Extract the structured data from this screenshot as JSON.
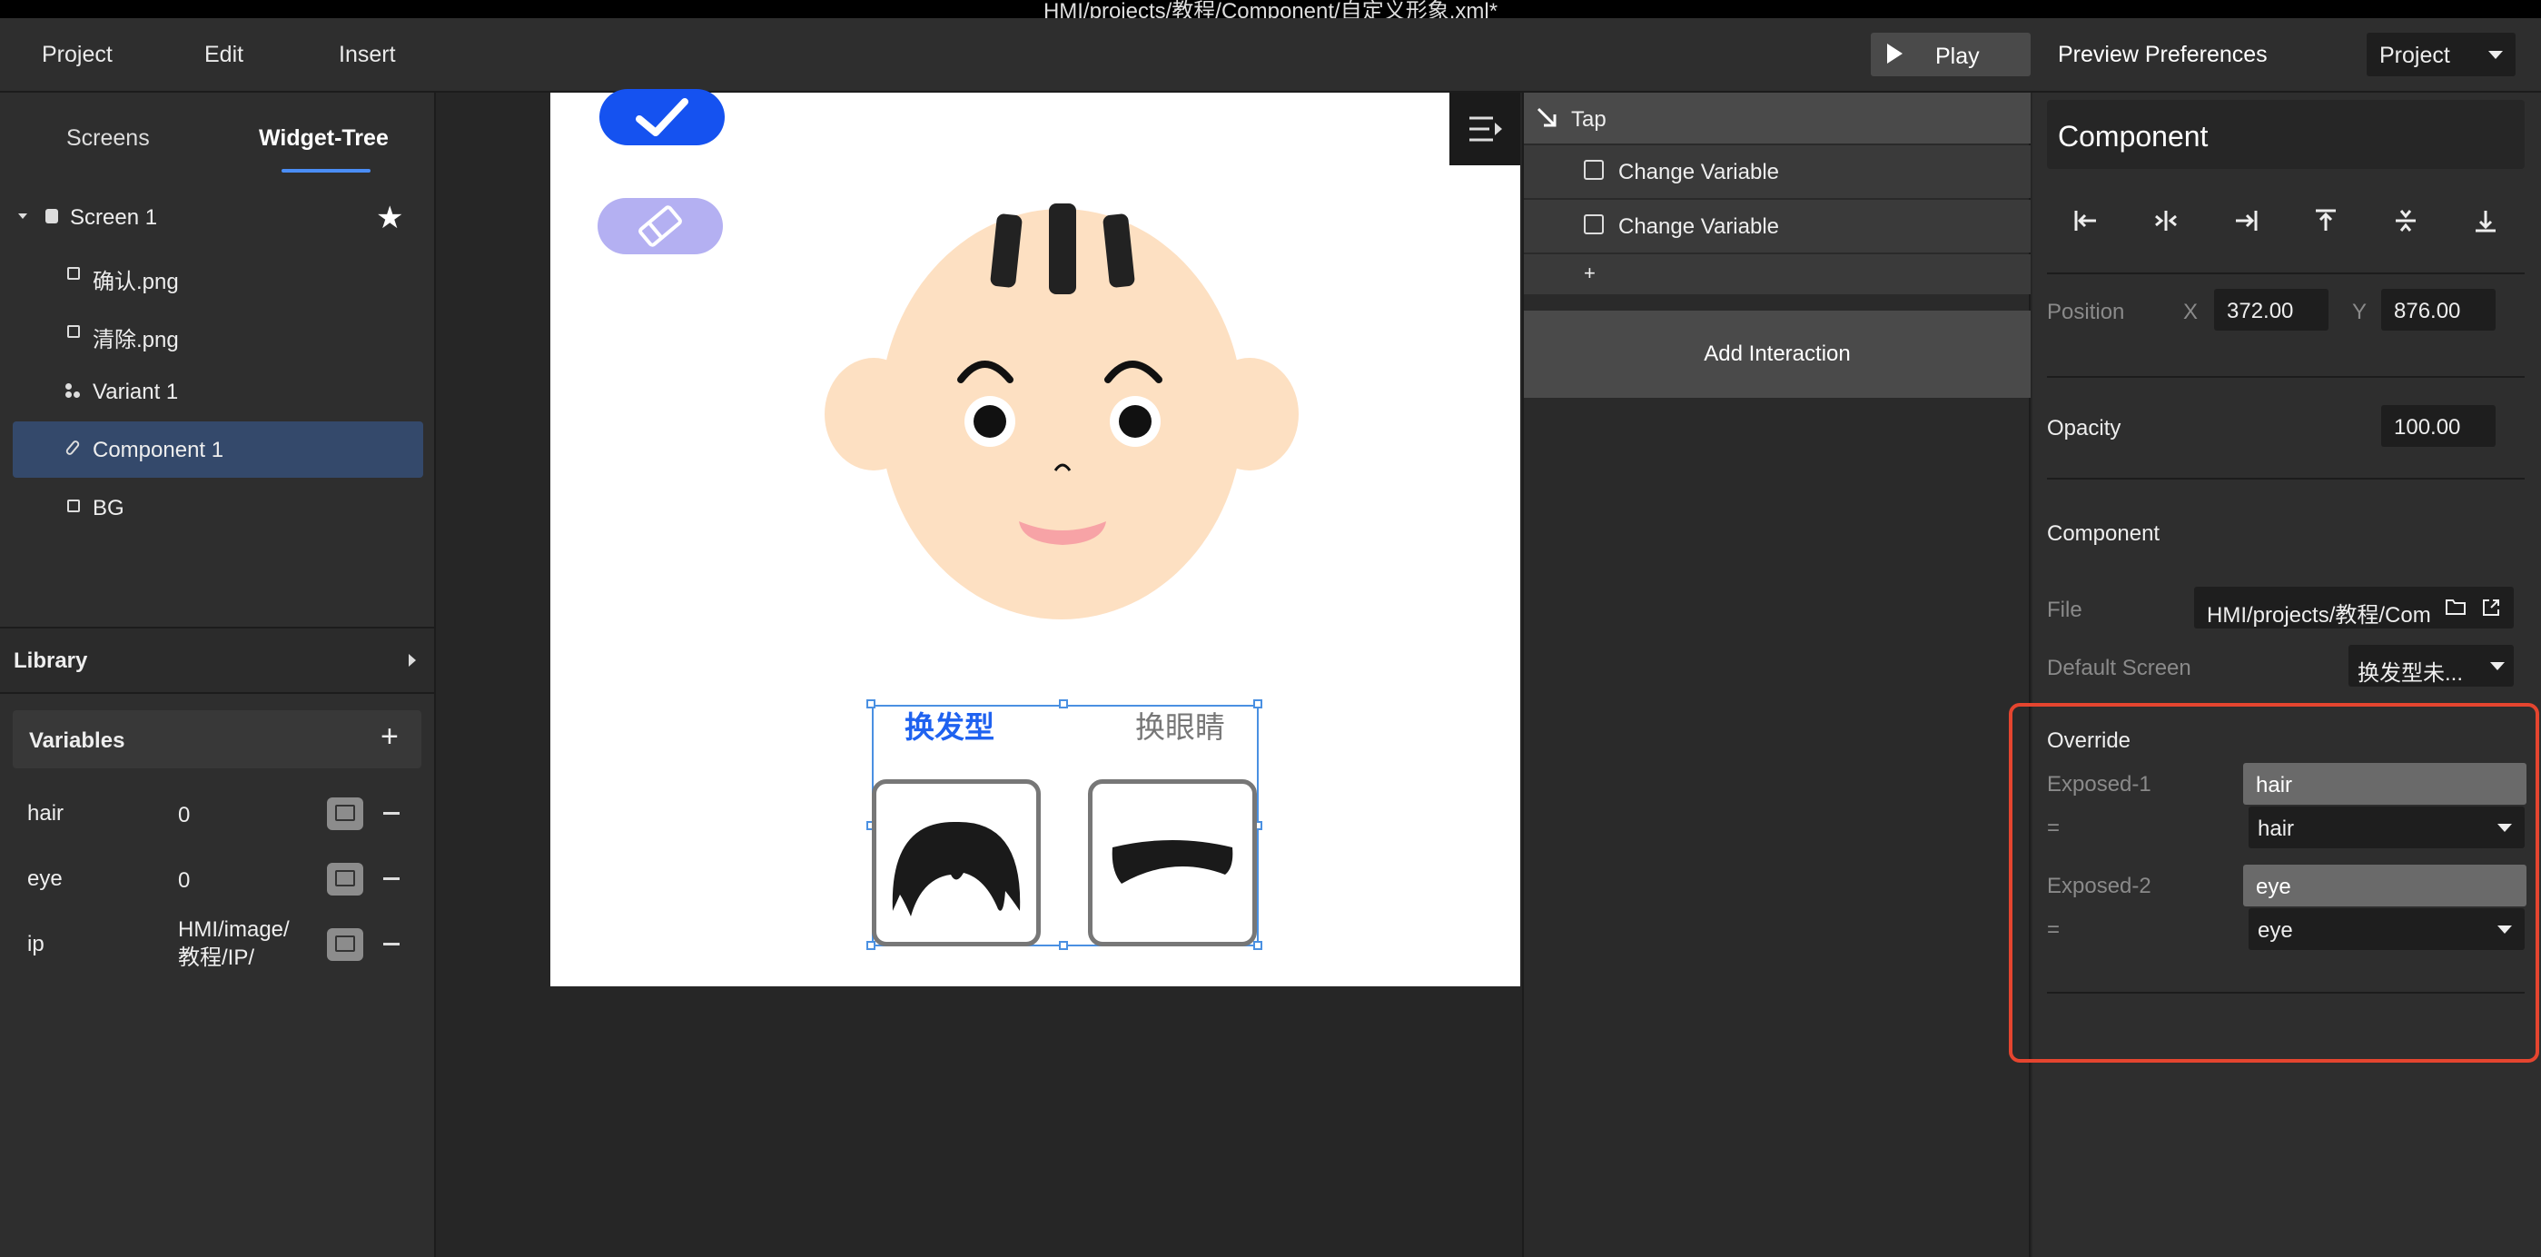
{
  "window": {
    "title": "HMI/projects/教程/Component/自定义形象.xml*"
  },
  "menubar": {
    "items": [
      "Project",
      "Edit",
      "Insert"
    ],
    "play_label": "Play",
    "preview_label": "Preview Preferences",
    "project_dropdown": "Project"
  },
  "left_panel": {
    "tabs": [
      "Screens",
      "Widget-Tree"
    ],
    "active_tab": "Widget-Tree",
    "tree": [
      {
        "label": "Screen 1",
        "icon": "screen-icon"
      },
      {
        "label": "确认.png",
        "icon": "image-icon"
      },
      {
        "label": "清除.png",
        "icon": "image-icon"
      },
      {
        "label": "Variant 1",
        "icon": "variant-icon"
      },
      {
        "label": "Component 1",
        "icon": "component-icon",
        "selected": true
      },
      {
        "label": "BG",
        "icon": "rect-icon"
      }
    ],
    "library_label": "Library",
    "variables_label": "Variables",
    "variables": [
      {
        "name": "hair",
        "value": "0"
      },
      {
        "name": "eye",
        "value": "0"
      },
      {
        "name": "ip",
        "value_line1": "HMI/image/",
        "value_line2": "教程/IP/"
      }
    ]
  },
  "canvas": {
    "widget_tabs": {
      "hair_tab": "换发型",
      "eye_tab": "换眼睛"
    },
    "colors": {
      "skin": "#fde0c2",
      "check_button": "#1552f0",
      "erase_button": "#b4b0f2",
      "mouth": "#f7a3a6",
      "selection": "#4a90e2"
    }
  },
  "interaction_panel": {
    "trigger": "Tap",
    "actions": [
      "Change Variable",
      "Change Variable"
    ],
    "add_action": "+",
    "add_interaction": "Add Interaction"
  },
  "properties": {
    "component_name": "Component",
    "position_label": "Position",
    "x_label": "X",
    "x_value": "372.00",
    "y_label": "Y",
    "y_value": "876.00",
    "opacity_label": "Opacity",
    "opacity_value": "100.00",
    "component_section": "Component",
    "file_label": "File",
    "file_value": "HMI/projects/教程/Com",
    "default_screen_label": "Default Screen",
    "default_screen_value": "换发型未...",
    "override_label": "Override",
    "exposed": [
      {
        "label": "Exposed-1",
        "name": "hair",
        "eq": "=",
        "value": "hair"
      },
      {
        "label": "Exposed-2",
        "name": "eye",
        "eq": "=",
        "value": "eye"
      }
    ],
    "highlight_color": "#e5452f"
  }
}
